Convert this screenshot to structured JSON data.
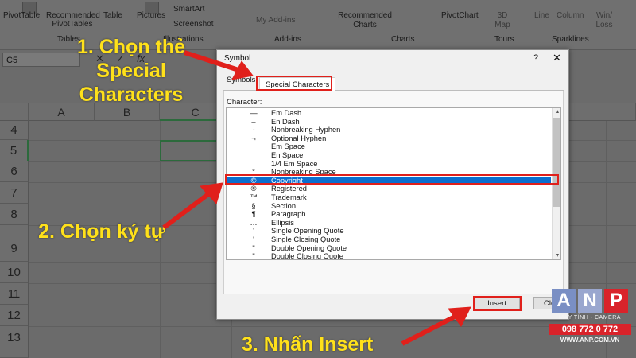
{
  "ribbon": {
    "items": [
      "PivotTable",
      "Recommended PivotTables",
      "Table",
      "Pictures",
      "SmartArt",
      "Screenshot",
      "My Add-ins",
      "Recommended Charts",
      "PivotChart",
      "3D Map",
      "Line",
      "Column",
      "Win/ Loss"
    ],
    "groups": [
      "Tables",
      "Illustrations",
      "Add-ins",
      "Charts",
      "Tours",
      "Sparklines"
    ]
  },
  "formula_bar": {
    "name_box": "C5",
    "cancel": "✕",
    "enter": "✓",
    "fx": "fx"
  },
  "sheet": {
    "columns": [
      "A",
      "B",
      "C"
    ],
    "rows": [
      "4",
      "5",
      "6",
      "7",
      "8",
      "9",
      "10",
      "11",
      "12",
      "13"
    ]
  },
  "dialog": {
    "title": "Symbol",
    "help": "?",
    "close": "✕",
    "tabs": [
      "Symbols",
      "Special Characters"
    ],
    "character_label": "Character:",
    "characters": [
      {
        "symbol": "—",
        "name": "Em Dash"
      },
      {
        "symbol": "–",
        "name": "En Dash"
      },
      {
        "symbol": "-",
        "name": "Nonbreaking Hyphen"
      },
      {
        "symbol": "¬",
        "name": "Optional Hyphen"
      },
      {
        "symbol": "",
        "name": "Em Space"
      },
      {
        "symbol": "",
        "name": "En Space"
      },
      {
        "symbol": "",
        "name": "1/4 Em Space"
      },
      {
        "symbol": "°",
        "name": "Nonbreaking Space"
      },
      {
        "symbol": "©",
        "name": "Copyright"
      },
      {
        "symbol": "®",
        "name": "Registered"
      },
      {
        "symbol": "™",
        "name": "Trademark"
      },
      {
        "symbol": "§",
        "name": "Section"
      },
      {
        "symbol": "¶",
        "name": "Paragraph"
      },
      {
        "symbol": "…",
        "name": "Ellipsis"
      },
      {
        "symbol": "'",
        "name": "Single Opening Quote"
      },
      {
        "symbol": "'",
        "name": "Single Closing Quote"
      },
      {
        "symbol": "\"",
        "name": "Double Opening Quote"
      },
      {
        "symbol": "\"",
        "name": "Double Closing Quote"
      }
    ],
    "selected_index": 8,
    "insert_label": "Insert",
    "close_label": "Close"
  },
  "annotations": {
    "step1": "1. Chọn thẻ Special Characters",
    "step2": "2. Chọn ký tự",
    "step3": "3. Nhấn Insert"
  },
  "logo": {
    "letters": [
      "A",
      "N",
      "P"
    ],
    "tagline": "MÁY TÍNH · CAMERA",
    "phone": "098 772 0 772",
    "url": "WWW.ANP.COM.VN"
  },
  "colors": {
    "accent_red": "#e0201b",
    "annotation_yellow": "#ffe11a",
    "selection_blue": "#0b6fcf"
  }
}
